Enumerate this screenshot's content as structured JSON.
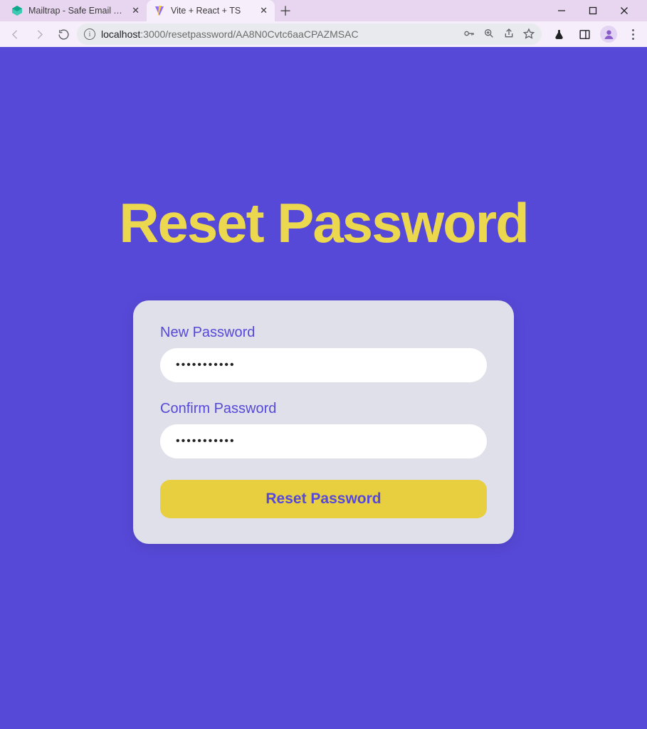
{
  "window": {
    "tabs": [
      {
        "title": "Mailtrap - Safe Email Testing",
        "active": false
      },
      {
        "title": "Vite + React + TS",
        "active": true
      }
    ]
  },
  "omnibox": {
    "host": "localhost",
    "port_and_path": ":3000/resetpassword/AA8N0Cvtc6aaCPAZMSAC"
  },
  "page": {
    "heading": "Reset Password",
    "new_password_label": "New Password",
    "new_password_value": "•••••••••••",
    "confirm_password_label": "Confirm Password",
    "confirm_password_value": "•••••••••••",
    "submit_label": "Reset Password"
  },
  "colors": {
    "page_bg": "#5749d8",
    "heading": "#ecd84f",
    "card_bg": "#dfe0ea",
    "accent_button": "#e7cf3f"
  }
}
